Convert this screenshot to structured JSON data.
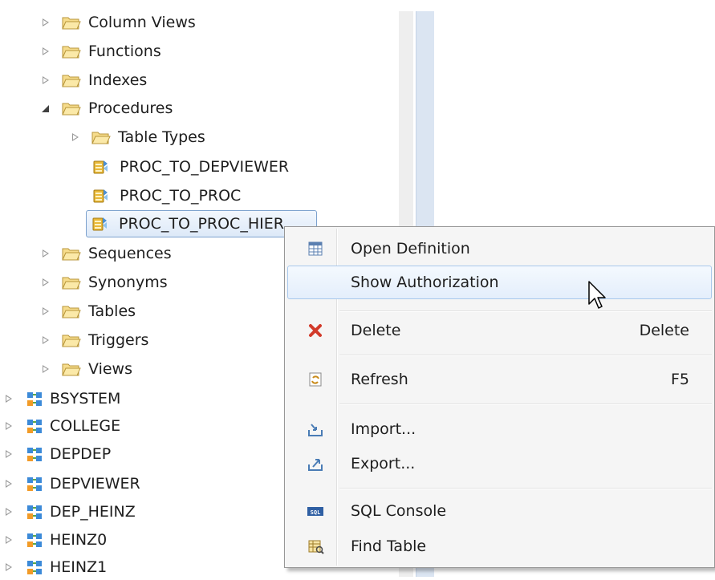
{
  "tree": {
    "folders": [
      {
        "label": "Column Views",
        "state": "collapsed"
      },
      {
        "label": "Functions",
        "state": "collapsed"
      },
      {
        "label": "Indexes",
        "state": "collapsed"
      },
      {
        "label": "Procedures",
        "state": "expanded"
      }
    ],
    "procedures": {
      "table_types": "Table Types",
      "items": [
        "PROC_TO_DEPVIEWER",
        "PROC_TO_PROC",
        "PROC_TO_PROC_HIER"
      ]
    },
    "folders_after": [
      "Sequences",
      "Synonyms",
      "Tables",
      "Triggers",
      "Views"
    ],
    "schemas": [
      "BSYSTEM",
      "COLLEGE",
      "DEPDEP",
      "DEPVIEWER",
      "DEP_HEINZ",
      "HEINZ0",
      "HEINZ1"
    ]
  },
  "context_menu": {
    "items": [
      {
        "label": "Open Definition",
        "shortcut": "",
        "icon": "table-definition-icon"
      },
      {
        "label": "Show Authorization",
        "shortcut": "",
        "icon": ""
      },
      {
        "label": "Delete",
        "shortcut": "Delete",
        "icon": "delete-x-icon"
      },
      {
        "label": "Refresh",
        "shortcut": "F5",
        "icon": "refresh-icon"
      },
      {
        "label": "Import...",
        "shortcut": "",
        "icon": "import-icon"
      },
      {
        "label": "Export...",
        "shortcut": "",
        "icon": "export-icon"
      },
      {
        "label": "SQL Console",
        "shortcut": "",
        "icon": "sql-console-icon"
      },
      {
        "label": "Find Table",
        "shortcut": "",
        "icon": "find-table-icon"
      }
    ]
  },
  "colors": {
    "folder": "#e8c25a",
    "selection_border": "#7da2ce",
    "menu_highlight": "#e4eefb",
    "delete_red": "#d23a2a"
  }
}
